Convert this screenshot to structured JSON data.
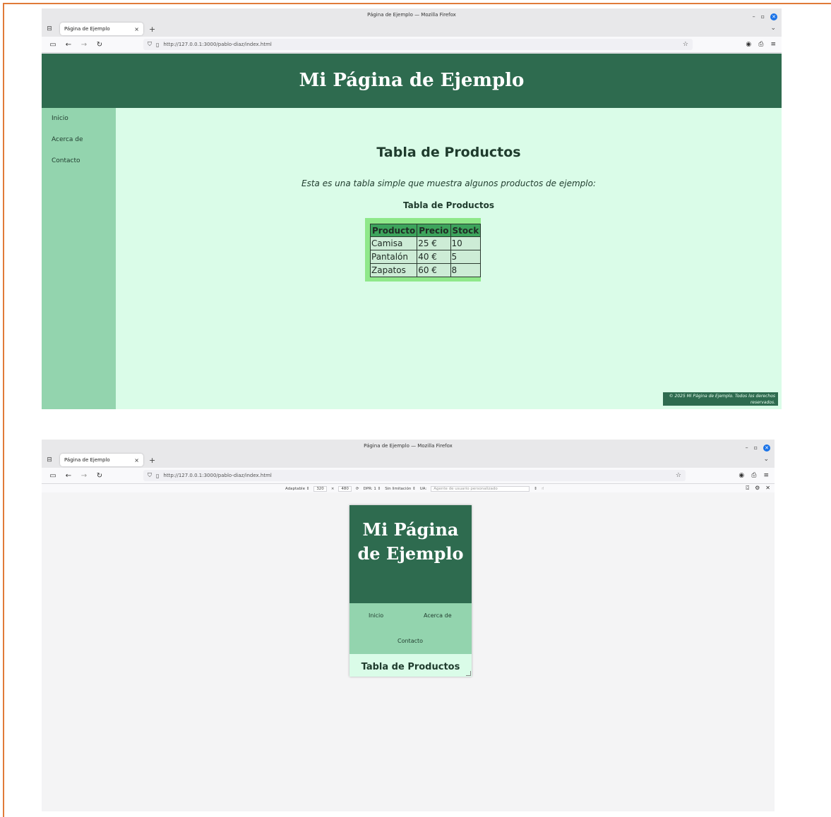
{
  "window_title": "Página de Ejemplo — Mozilla Firefox",
  "tab_title": "Página de Ejemplo",
  "url": "http://127.0.0.1:3000/pablo-diaz/index.html",
  "page": {
    "header_title": "Mi Página de Ejemplo",
    "nav": [
      "Inicio",
      "Acerca de",
      "Contacto"
    ],
    "section_title": "Tabla de Productos",
    "description": "Esta es una tabla simple que muestra algunos productos de ejemplo:",
    "table_caption": "Tabla de Productos",
    "table": {
      "headers": [
        "Producto",
        "Precio",
        "Stock"
      ],
      "rows": [
        [
          "Camisa",
          "25 €",
          "10"
        ],
        [
          "Pantalón",
          "40 €",
          "5"
        ],
        [
          "Zapatos",
          "60 €",
          "8"
        ]
      ]
    },
    "footer": "© 2025 Mi Página de Ejemplo. Todos los derechos reservados."
  },
  "responsive_toolbar": {
    "device": "Adaptable",
    "width": "320",
    "times": "×",
    "height": "480",
    "dpr": "DPR: 1",
    "throttle": "Sin limitación",
    "ua_label": "UA:",
    "ua_placeholder": "Agente de usuario personalizado"
  },
  "mobile": {
    "header_title": "Mi Página de Ejemplo",
    "nav_inicio": "Inicio",
    "nav_acerca": "Acerca de",
    "nav_contacto": "Contacto",
    "section_title": "Tabla de Productos"
  },
  "colors": {
    "header": "#2e6b4f",
    "sidebar": "#93d4ae",
    "content_bg": "#dafce8",
    "table_bg": "#8fe88a",
    "table_header": "#3da45c",
    "frame_accent": "#e07b39"
  }
}
